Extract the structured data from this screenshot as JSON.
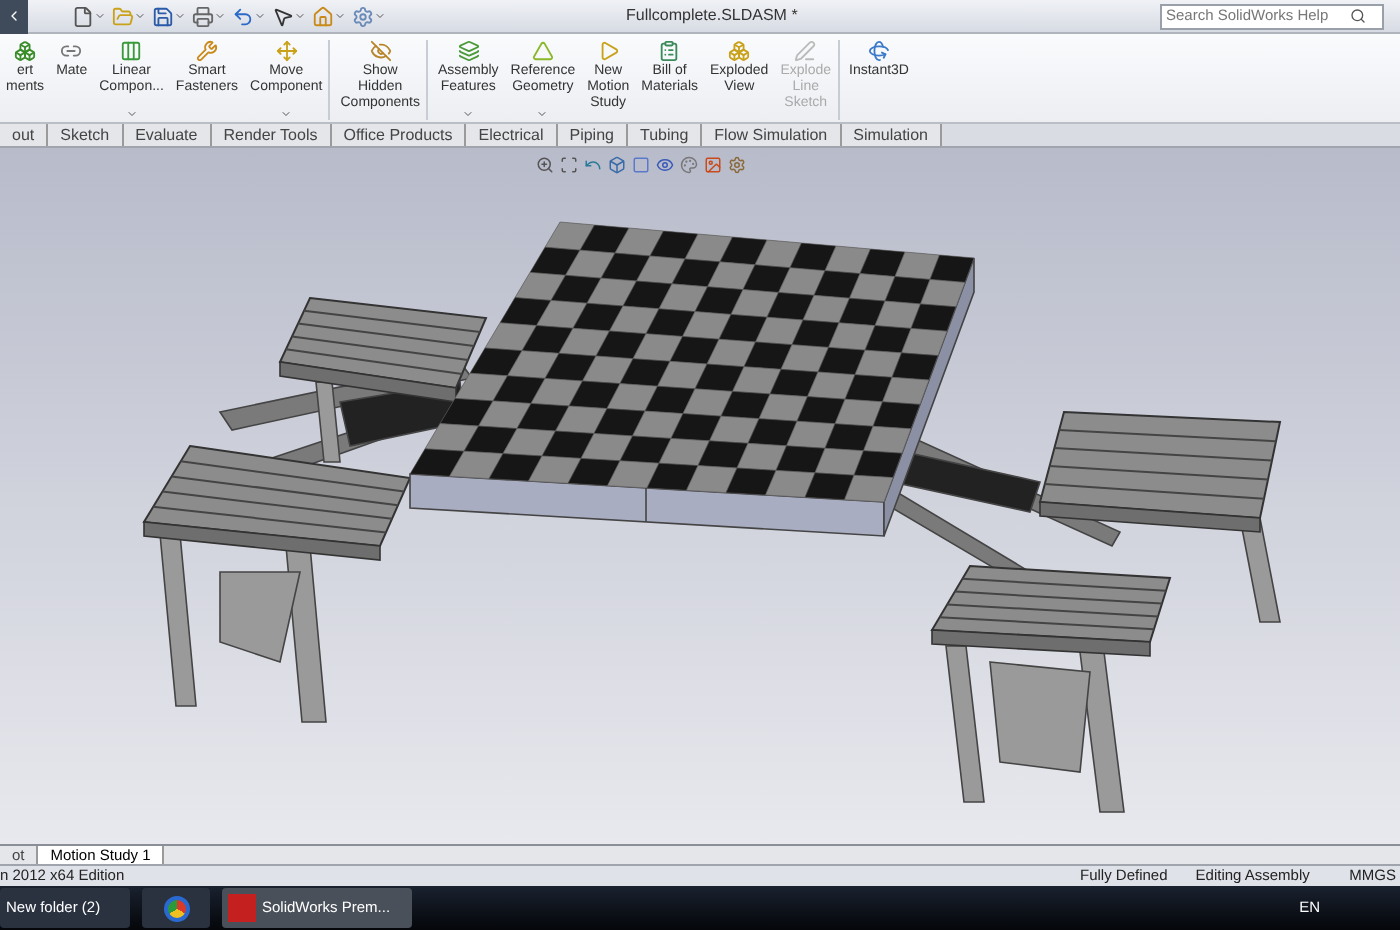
{
  "window": {
    "title": "Fullcomplete.SLDASM *",
    "search": {
      "placeholder": "Search SolidWorks Help"
    }
  },
  "ribbon": [
    {
      "label": "ert\nments",
      "dropdown": false,
      "disabled": false,
      "separator_after": false
    },
    {
      "label": "Mate",
      "dropdown": false,
      "disabled": false,
      "separator_after": false
    },
    {
      "label": "Linear\nCompon...",
      "dropdown": true,
      "disabled": false,
      "separator_after": false
    },
    {
      "label": "Smart\nFasteners",
      "dropdown": false,
      "disabled": false,
      "separator_after": false
    },
    {
      "label": "Move\nComponent",
      "dropdown": true,
      "disabled": false,
      "separator_after": true
    },
    {
      "label": "Show\nHidden\nComponents",
      "dropdown": false,
      "disabled": false,
      "separator_after": true
    },
    {
      "label": "Assembly\nFeatures",
      "dropdown": true,
      "disabled": false,
      "separator_after": false
    },
    {
      "label": "Reference\nGeometry",
      "dropdown": true,
      "disabled": false,
      "separator_after": false
    },
    {
      "label": "New\nMotion\nStudy",
      "dropdown": false,
      "disabled": false,
      "separator_after": false
    },
    {
      "label": "Bill of\nMaterials",
      "dropdown": false,
      "disabled": false,
      "separator_after": false
    },
    {
      "label": "Exploded\nView",
      "dropdown": false,
      "disabled": false,
      "separator_after": false
    },
    {
      "label": "Explode\nLine\nSketch",
      "dropdown": false,
      "disabled": true,
      "separator_after": true
    },
    {
      "label": "Instant3D",
      "dropdown": false,
      "disabled": false,
      "separator_after": false
    }
  ],
  "tabs": [
    {
      "label": "out",
      "selected": false
    },
    {
      "label": "Sketch",
      "selected": false
    },
    {
      "label": "Evaluate",
      "selected": false
    },
    {
      "label": "Render Tools",
      "selected": false
    },
    {
      "label": "Office Products",
      "selected": false
    },
    {
      "label": "Electrical",
      "selected": false
    },
    {
      "label": "Piping",
      "selected": false
    },
    {
      "label": "Tubing",
      "selected": false
    },
    {
      "label": "Flow Simulation",
      "selected": false
    },
    {
      "label": "Simulation",
      "selected": false
    }
  ],
  "bottom_tabs": [
    {
      "label": "ot",
      "selected": false
    },
    {
      "label": "Motion Study 1",
      "selected": true
    }
  ],
  "status_bar": {
    "edition": "n 2012 x64 Edition",
    "state": "Fully Defined",
    "mode": "Editing Assembly",
    "units": "MMGS"
  },
  "taskbar": {
    "items": [
      {
        "label": "New folder (2)",
        "kind": "folder"
      },
      {
        "kind": "browser"
      },
      {
        "label": "SolidWorks Prem...",
        "kind": "app"
      }
    ],
    "language": "EN"
  }
}
